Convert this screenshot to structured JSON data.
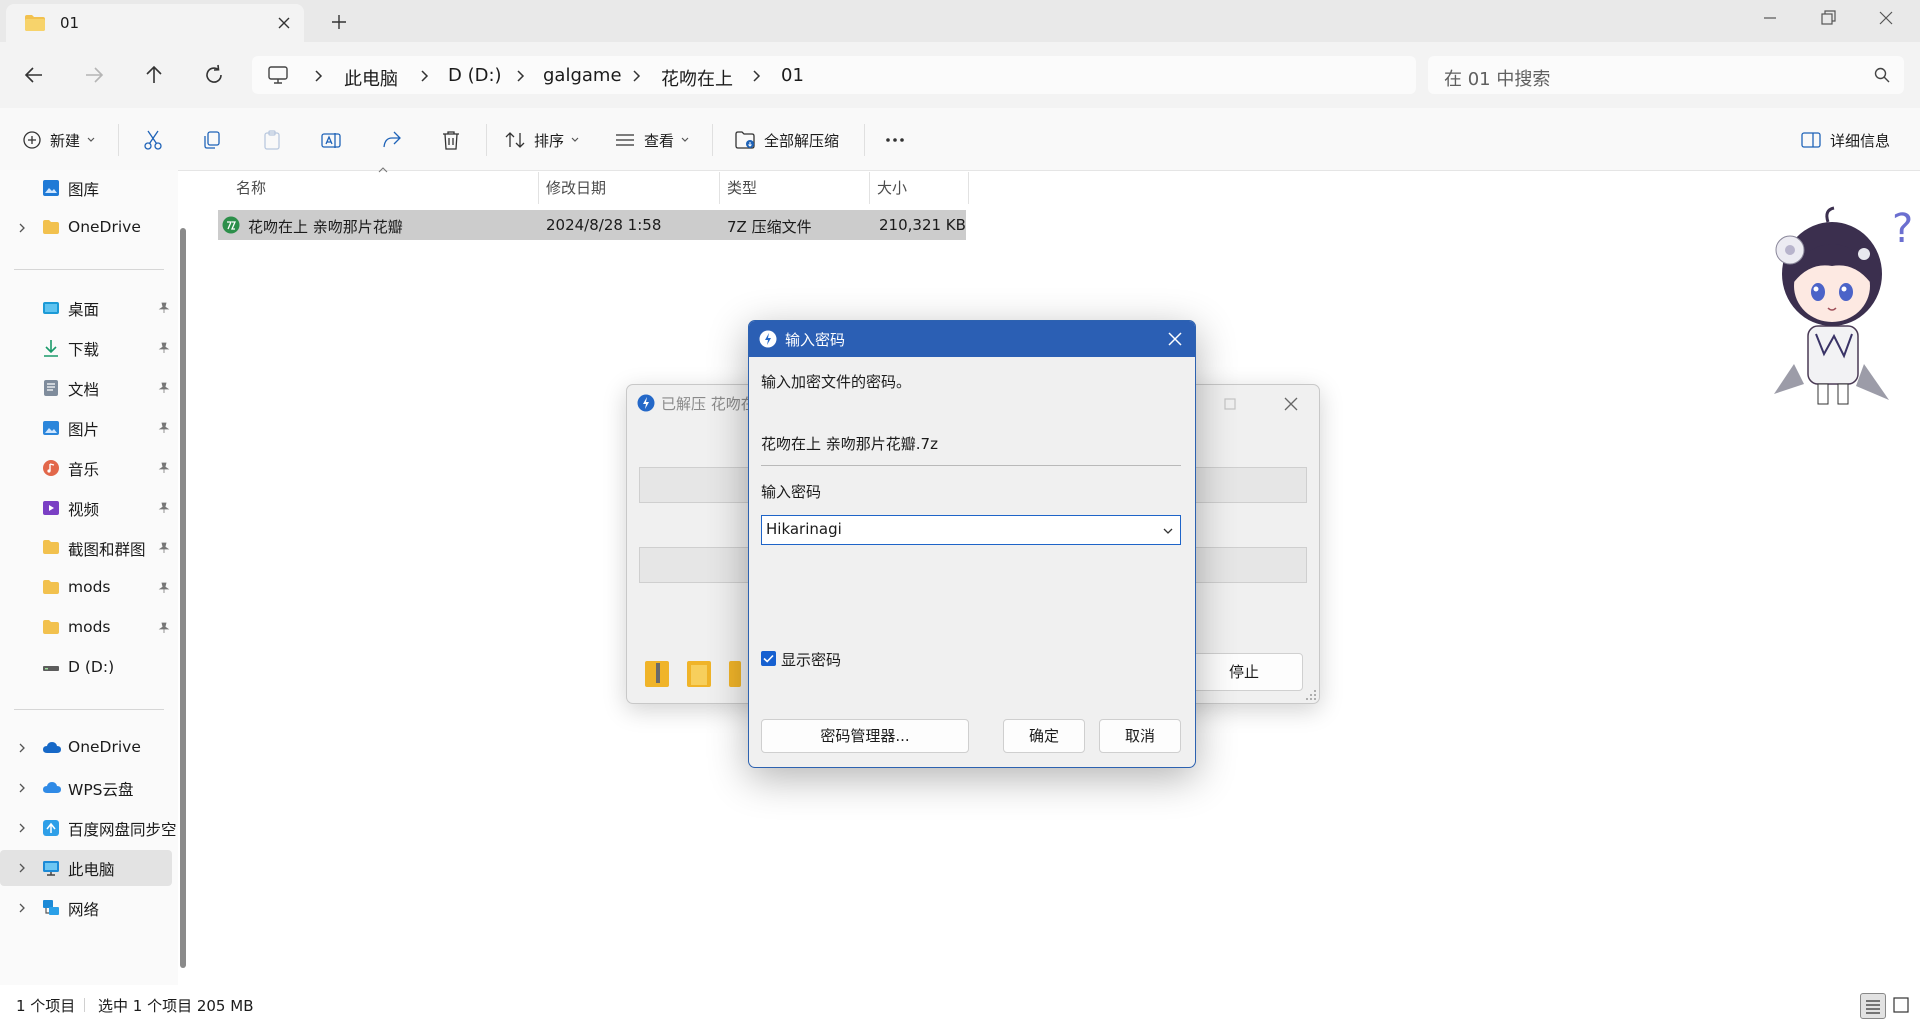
{
  "tab": {
    "title": "01"
  },
  "breadcrumb": {
    "items": [
      "此电脑",
      "D (D:)",
      "galgame",
      "花吻在上",
      "01"
    ]
  },
  "search": {
    "placeholder": "在 01 中搜索"
  },
  "toolbar": {
    "new_label": "新建",
    "sort_label": "排序",
    "view_label": "查看",
    "extract_all_label": "全部解压缩",
    "details_label": "详细信息"
  },
  "sidebar": {
    "items": [
      {
        "label": "图库",
        "icon": "gallery-icon"
      },
      {
        "label": "OneDrive",
        "icon": "folder-icon"
      },
      {
        "label": "桌面",
        "icon": "desktop-icon"
      },
      {
        "label": "下载",
        "icon": "download-icon"
      },
      {
        "label": "文档",
        "icon": "document-icon"
      },
      {
        "label": "图片",
        "icon": "pictures-icon"
      },
      {
        "label": "音乐",
        "icon": "music-icon"
      },
      {
        "label": "视频",
        "icon": "video-icon"
      },
      {
        "label": "截图和群图",
        "icon": "folder-icon"
      },
      {
        "label": "mods",
        "icon": "folder-icon"
      },
      {
        "label": "mods",
        "icon": "folder-icon"
      },
      {
        "label": "D (D:)",
        "icon": "drive-icon"
      },
      {
        "label": "OneDrive",
        "icon": "cloud-icon"
      },
      {
        "label": "WPS云盘",
        "icon": "wps-cloud-icon"
      },
      {
        "label": "百度网盘同步空",
        "icon": "baidu-sync-icon"
      },
      {
        "label": "此电脑",
        "icon": "computer-icon"
      },
      {
        "label": "网络",
        "icon": "network-icon"
      }
    ]
  },
  "file_list": {
    "columns": [
      "名称",
      "修改日期",
      "类型",
      "大小"
    ],
    "rows": [
      {
        "name": "花吻在上 亲吻那片花瓣",
        "date": "2024/8/28 1:58",
        "type": "7Z 压缩文件",
        "size": "210,321 KB"
      }
    ]
  },
  "status": {
    "count": "1 个项目",
    "selection": "选中 1 个项目 205 MB"
  },
  "progress_window": {
    "title": "已解压 花吻在",
    "stop_label": "停止"
  },
  "password_dialog": {
    "title": "输入密码",
    "prompt": "输入加密文件的密码。",
    "filename": "花吻在上 亲吻那片花瓣.7z",
    "field_label": "输入密码",
    "password_value": "Hikarinagi",
    "show_password_label": "显示密码",
    "show_password_checked": true,
    "manager_button": "密码管理器...",
    "ok_button": "确定",
    "cancel_button": "取消"
  },
  "colors": {
    "accent": "#2b5fb4",
    "folder": "#f2c14e",
    "selection": "#cccccc"
  }
}
